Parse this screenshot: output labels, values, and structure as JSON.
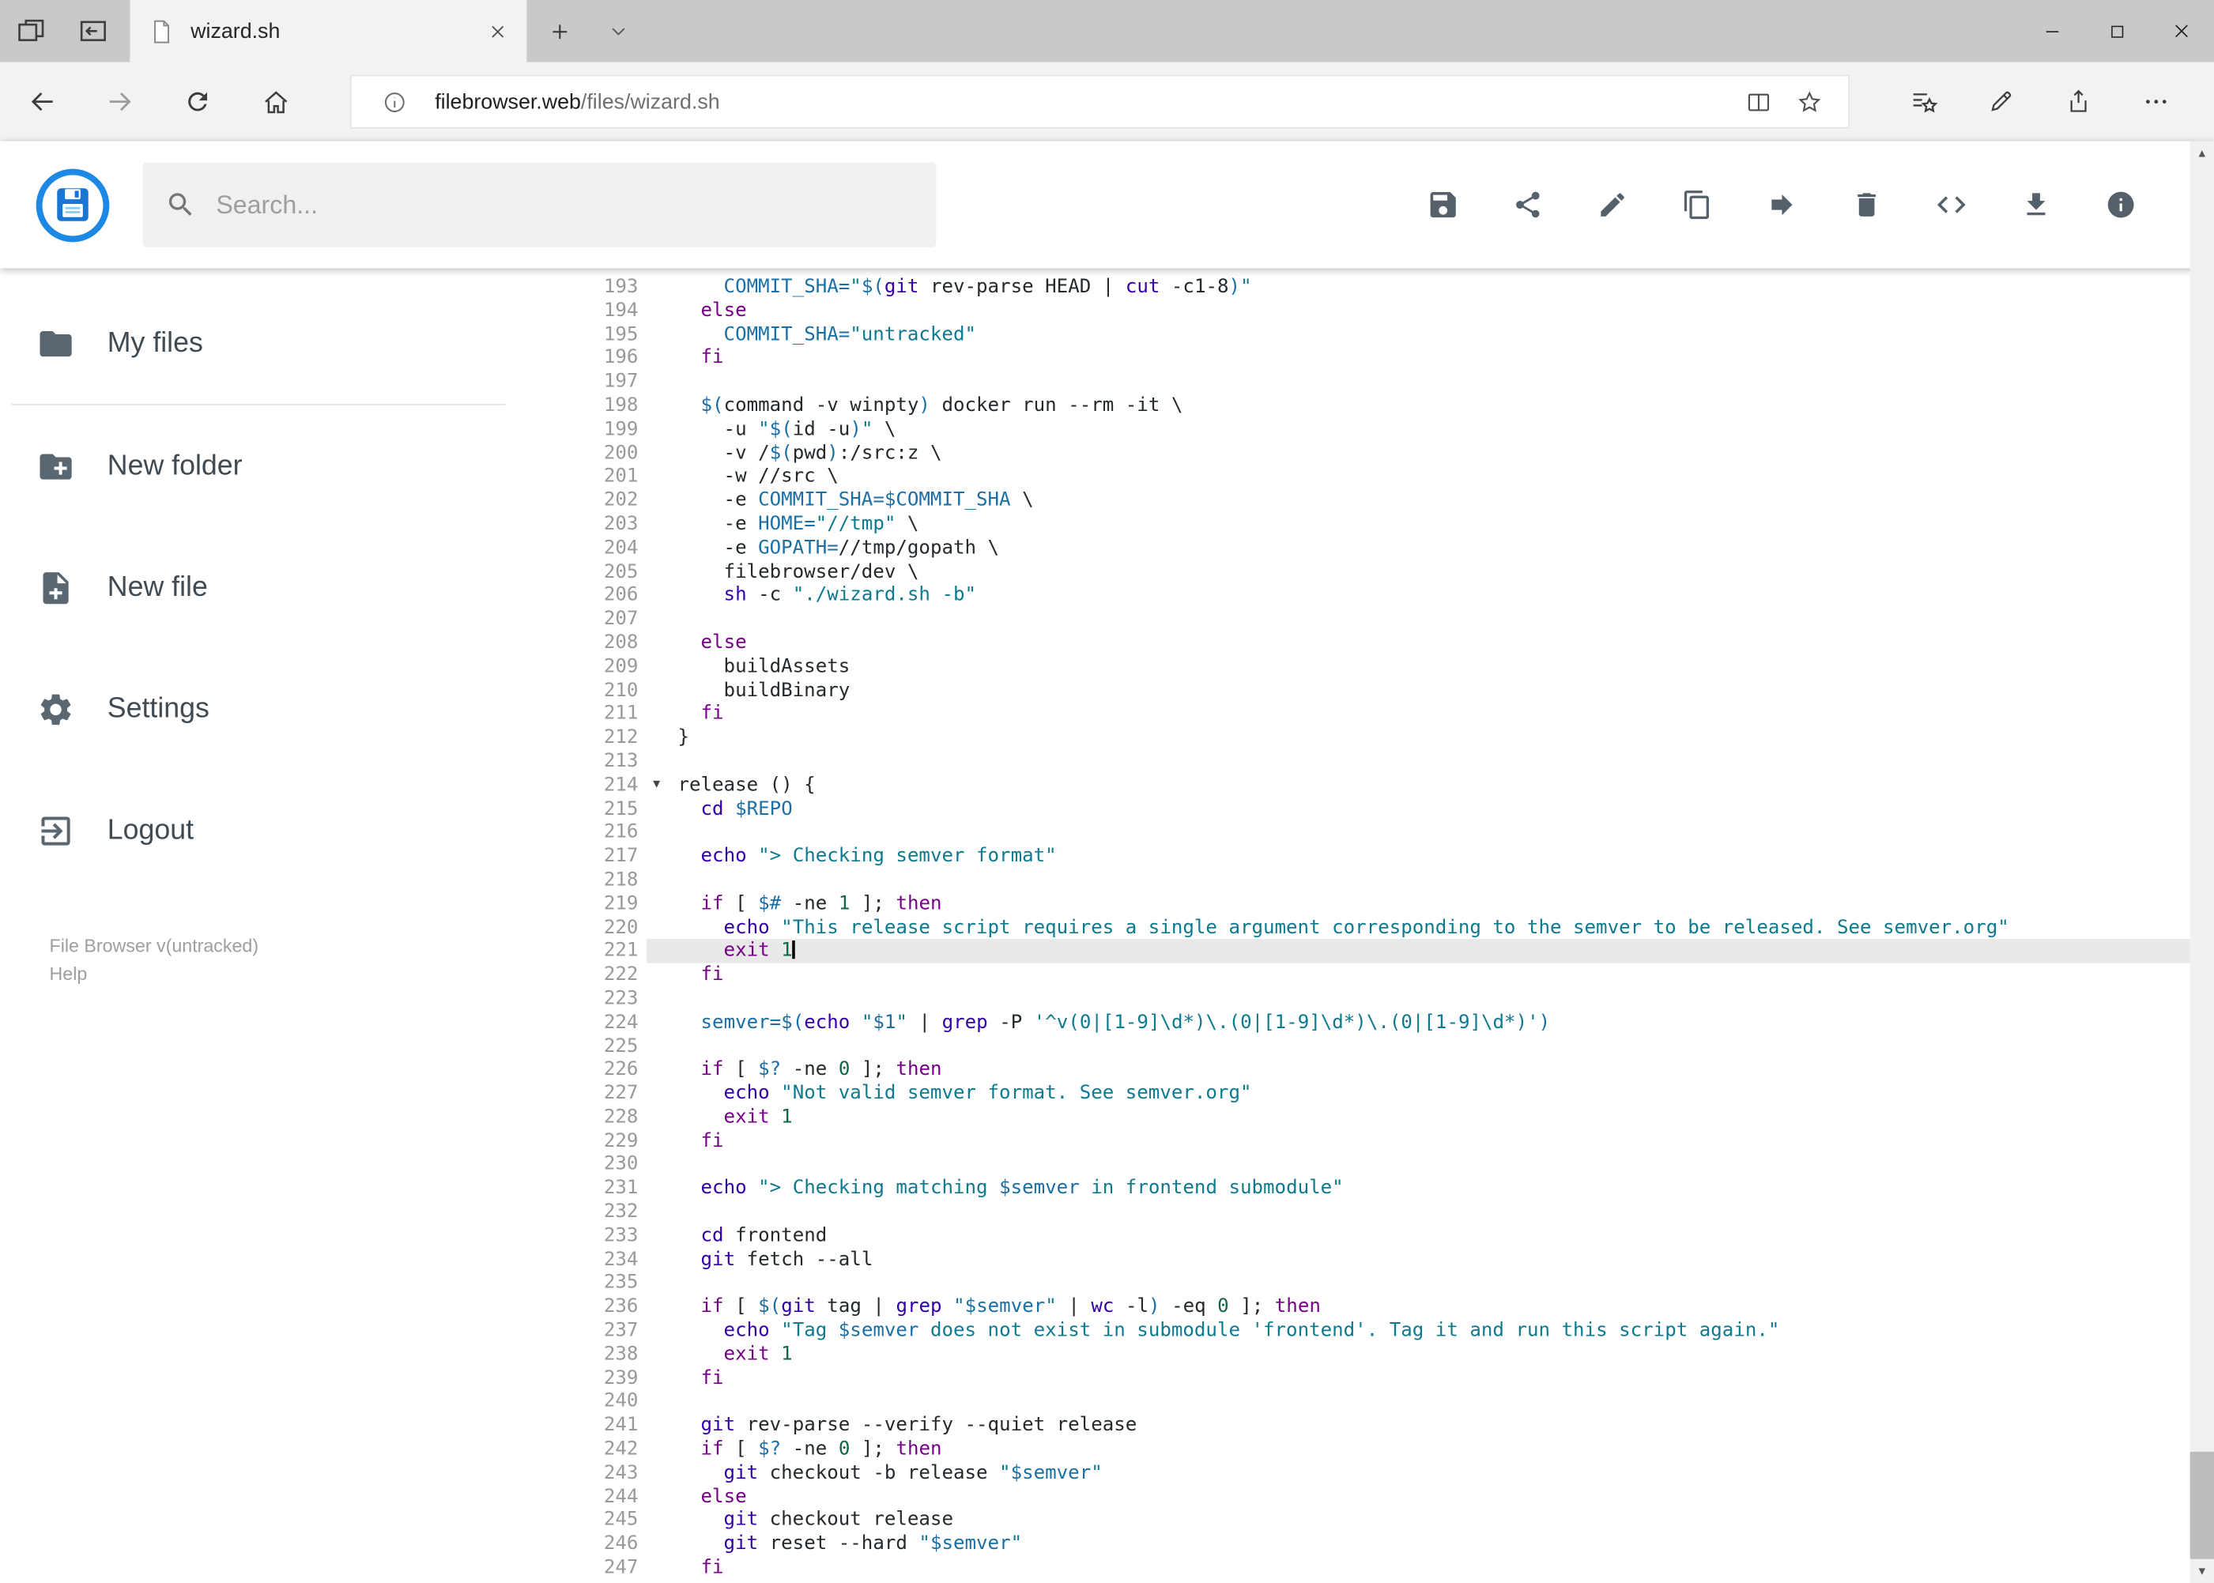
{
  "browser": {
    "tab": {
      "title": "wizard.sh"
    },
    "address": {
      "host": "filebrowser.web",
      "path": "/files/wizard.sh"
    }
  },
  "app_header": {
    "search_placeholder": "Search...",
    "toolbar_icons": [
      "save",
      "share",
      "rename",
      "copy",
      "move",
      "delete",
      "code",
      "download",
      "info"
    ]
  },
  "sidebar": {
    "items": [
      {
        "label": "My files",
        "icon": "folder"
      },
      {
        "label": "New folder",
        "icon": "create-new-folder"
      },
      {
        "label": "New file",
        "icon": "note-add"
      },
      {
        "label": "Settings",
        "icon": "settings-gear"
      },
      {
        "label": "Logout",
        "icon": "exit-to-app"
      }
    ],
    "footer": {
      "version": "File Browser v(untracked)",
      "help": "Help"
    }
  },
  "colors": {
    "accent": "#2196f3",
    "active_line": "#e8e8e8"
  },
  "editor": {
    "language": "shell",
    "active_line": 221,
    "cursor_line": 221,
    "lines": [
      {
        "n": 193,
        "segs": [
          [
            "    ",
            "d"
          ],
          [
            "COMMIT_SHA=",
            "v"
          ],
          [
            "\"",
            "s"
          ],
          [
            "$(",
            "v"
          ],
          [
            "git",
            "b"
          ],
          [
            " rev-parse HEAD | ",
            "d"
          ],
          [
            "cut",
            "b"
          ],
          [
            " -c1-8",
            "d"
          ],
          [
            ")",
            "v"
          ],
          [
            "\"",
            "s"
          ]
        ]
      },
      {
        "n": 194,
        "segs": [
          [
            "  ",
            "d"
          ],
          [
            "else",
            "k"
          ]
        ]
      },
      {
        "n": 195,
        "segs": [
          [
            "    ",
            "d"
          ],
          [
            "COMMIT_SHA=",
            "v"
          ],
          [
            "\"untracked\"",
            "s"
          ]
        ]
      },
      {
        "n": 196,
        "segs": [
          [
            "  ",
            "d"
          ],
          [
            "fi",
            "k"
          ]
        ]
      },
      {
        "n": 197,
        "segs": []
      },
      {
        "n": 198,
        "segs": [
          [
            "  ",
            "d"
          ],
          [
            "$(",
            "v"
          ],
          [
            "command -v winpty",
            "d"
          ],
          [
            ")",
            "v"
          ],
          [
            " docker run --rm -it \\",
            "d"
          ]
        ]
      },
      {
        "n": 199,
        "segs": [
          [
            "    -u ",
            "d"
          ],
          [
            "\"",
            "s"
          ],
          [
            "$(",
            "v"
          ],
          [
            "id -u",
            "d"
          ],
          [
            ")",
            "v"
          ],
          [
            "\"",
            "s"
          ],
          [
            " \\",
            "d"
          ]
        ]
      },
      {
        "n": 200,
        "segs": [
          [
            "    -v /",
            "d"
          ],
          [
            "$(",
            "v"
          ],
          [
            "pwd",
            "d"
          ],
          [
            ")",
            "v"
          ],
          [
            ":/src:z \\",
            "d"
          ]
        ]
      },
      {
        "n": 201,
        "segs": [
          [
            "    -w //src \\",
            "d"
          ]
        ]
      },
      {
        "n": 202,
        "segs": [
          [
            "    -e ",
            "d"
          ],
          [
            "COMMIT_SHA=",
            "v"
          ],
          [
            "$COMMIT_SHA",
            "v"
          ],
          [
            " \\",
            "d"
          ]
        ]
      },
      {
        "n": 203,
        "segs": [
          [
            "    -e ",
            "d"
          ],
          [
            "HOME=",
            "v"
          ],
          [
            "\"//tmp\"",
            "s"
          ],
          [
            " \\",
            "d"
          ]
        ]
      },
      {
        "n": 204,
        "segs": [
          [
            "    -e ",
            "d"
          ],
          [
            "GOPATH=",
            "v"
          ],
          [
            "//tmp/gopath \\",
            "d"
          ]
        ]
      },
      {
        "n": 205,
        "segs": [
          [
            "    filebrowser/dev \\",
            "d"
          ]
        ]
      },
      {
        "n": 206,
        "segs": [
          [
            "    ",
            "d"
          ],
          [
            "sh",
            "b"
          ],
          [
            " -c ",
            "d"
          ],
          [
            "\"./wizard.sh -b\"",
            "s"
          ]
        ]
      },
      {
        "n": 207,
        "segs": []
      },
      {
        "n": 208,
        "segs": [
          [
            "  ",
            "d"
          ],
          [
            "else",
            "k"
          ]
        ]
      },
      {
        "n": 209,
        "segs": [
          [
            "    buildAssets",
            "d"
          ]
        ]
      },
      {
        "n": 210,
        "segs": [
          [
            "    buildBinary",
            "d"
          ]
        ]
      },
      {
        "n": 211,
        "segs": [
          [
            "  ",
            "d"
          ],
          [
            "fi",
            "k"
          ]
        ]
      },
      {
        "n": 212,
        "segs": [
          [
            "}",
            "d"
          ]
        ]
      },
      {
        "n": 213,
        "segs": []
      },
      {
        "n": 214,
        "fold": true,
        "segs": [
          [
            "release () {",
            "d"
          ]
        ]
      },
      {
        "n": 215,
        "segs": [
          [
            "  ",
            "d"
          ],
          [
            "cd",
            "b"
          ],
          [
            " ",
            "d"
          ],
          [
            "$REPO",
            "v"
          ]
        ]
      },
      {
        "n": 216,
        "segs": []
      },
      {
        "n": 217,
        "segs": [
          [
            "  ",
            "d"
          ],
          [
            "echo",
            "b"
          ],
          [
            " ",
            "d"
          ],
          [
            "\"> Checking semver format\"",
            "s"
          ]
        ]
      },
      {
        "n": 218,
        "segs": []
      },
      {
        "n": 219,
        "segs": [
          [
            "  ",
            "d"
          ],
          [
            "if",
            "k"
          ],
          [
            " [ ",
            "d"
          ],
          [
            "$#",
            "v"
          ],
          [
            " -ne ",
            "d"
          ],
          [
            "1",
            "n"
          ],
          [
            " ]; ",
            "d"
          ],
          [
            "then",
            "k"
          ]
        ]
      },
      {
        "n": 220,
        "segs": [
          [
            "    ",
            "d"
          ],
          [
            "echo",
            "b"
          ],
          [
            " ",
            "d"
          ],
          [
            "\"This release script requires a single argument corresponding to the semver to be released. See semver.org\"",
            "s"
          ]
        ]
      },
      {
        "n": 221,
        "segs": [
          [
            "    ",
            "d"
          ],
          [
            "exit",
            "k"
          ],
          [
            " ",
            "d"
          ],
          [
            "1",
            "n"
          ]
        ]
      },
      {
        "n": 222,
        "segs": [
          [
            "  ",
            "d"
          ],
          [
            "fi",
            "k"
          ]
        ]
      },
      {
        "n": 223,
        "segs": []
      },
      {
        "n": 224,
        "segs": [
          [
            "  ",
            "d"
          ],
          [
            "semver=",
            "v"
          ],
          [
            "$(",
            "v"
          ],
          [
            "echo",
            "b"
          ],
          [
            " ",
            "d"
          ],
          [
            "\"",
            "s"
          ],
          [
            "$1",
            "v"
          ],
          [
            "\"",
            "s"
          ],
          [
            " | ",
            "d"
          ],
          [
            "grep",
            "b"
          ],
          [
            " -P ",
            "d"
          ],
          [
            "'^v(0|[1-9]\\d*)\\.(0|[1-9]\\d*)\\.(0|[1-9]\\d*)'",
            "s"
          ],
          [
            ")",
            "v"
          ]
        ]
      },
      {
        "n": 225,
        "segs": []
      },
      {
        "n": 226,
        "segs": [
          [
            "  ",
            "d"
          ],
          [
            "if",
            "k"
          ],
          [
            " [ ",
            "d"
          ],
          [
            "$?",
            "v"
          ],
          [
            " -ne ",
            "d"
          ],
          [
            "0",
            "n"
          ],
          [
            " ]; ",
            "d"
          ],
          [
            "then",
            "k"
          ]
        ]
      },
      {
        "n": 227,
        "segs": [
          [
            "    ",
            "d"
          ],
          [
            "echo",
            "b"
          ],
          [
            " ",
            "d"
          ],
          [
            "\"Not valid semver format. See semver.org\"",
            "s"
          ]
        ]
      },
      {
        "n": 228,
        "segs": [
          [
            "    ",
            "d"
          ],
          [
            "exit",
            "k"
          ],
          [
            " ",
            "d"
          ],
          [
            "1",
            "n"
          ]
        ]
      },
      {
        "n": 229,
        "segs": [
          [
            "  ",
            "d"
          ],
          [
            "fi",
            "k"
          ]
        ]
      },
      {
        "n": 230,
        "segs": []
      },
      {
        "n": 231,
        "segs": [
          [
            "  ",
            "d"
          ],
          [
            "echo",
            "b"
          ],
          [
            " ",
            "d"
          ],
          [
            "\"> Checking matching ",
            "s"
          ],
          [
            "$semver",
            "v"
          ],
          [
            " in frontend submodule\"",
            "s"
          ]
        ]
      },
      {
        "n": 232,
        "segs": []
      },
      {
        "n": 233,
        "segs": [
          [
            "  ",
            "d"
          ],
          [
            "cd",
            "b"
          ],
          [
            " frontend",
            "d"
          ]
        ]
      },
      {
        "n": 234,
        "segs": [
          [
            "  ",
            "d"
          ],
          [
            "git",
            "b"
          ],
          [
            " fetch --all",
            "d"
          ]
        ]
      },
      {
        "n": 235,
        "segs": []
      },
      {
        "n": 236,
        "segs": [
          [
            "  ",
            "d"
          ],
          [
            "if",
            "k"
          ],
          [
            " [ ",
            "d"
          ],
          [
            "$(",
            "v"
          ],
          [
            "git",
            "b"
          ],
          [
            " tag | ",
            "d"
          ],
          [
            "grep",
            "b"
          ],
          [
            " ",
            "d"
          ],
          [
            "\"",
            "s"
          ],
          [
            "$semver",
            "v"
          ],
          [
            "\"",
            "s"
          ],
          [
            " | ",
            "d"
          ],
          [
            "wc",
            "b"
          ],
          [
            " -l",
            "d"
          ],
          [
            ")",
            "v"
          ],
          [
            " -eq ",
            "d"
          ],
          [
            "0",
            "n"
          ],
          [
            " ]; ",
            "d"
          ],
          [
            "then",
            "k"
          ]
        ]
      },
      {
        "n": 237,
        "segs": [
          [
            "    ",
            "d"
          ],
          [
            "echo",
            "b"
          ],
          [
            " ",
            "d"
          ],
          [
            "\"Tag ",
            "s"
          ],
          [
            "$semver",
            "v"
          ],
          [
            " does not exist in submodule 'frontend'. Tag it and run this script again.\"",
            "s"
          ]
        ]
      },
      {
        "n": 238,
        "segs": [
          [
            "    ",
            "d"
          ],
          [
            "exit",
            "k"
          ],
          [
            " ",
            "d"
          ],
          [
            "1",
            "n"
          ]
        ]
      },
      {
        "n": 239,
        "segs": [
          [
            "  ",
            "d"
          ],
          [
            "fi",
            "k"
          ]
        ]
      },
      {
        "n": 240,
        "segs": []
      },
      {
        "n": 241,
        "segs": [
          [
            "  ",
            "d"
          ],
          [
            "git",
            "b"
          ],
          [
            " rev-parse --verify --quiet release",
            "d"
          ]
        ]
      },
      {
        "n": 242,
        "segs": [
          [
            "  ",
            "d"
          ],
          [
            "if",
            "k"
          ],
          [
            " [ ",
            "d"
          ],
          [
            "$?",
            "v"
          ],
          [
            " -ne ",
            "d"
          ],
          [
            "0",
            "n"
          ],
          [
            " ]; ",
            "d"
          ],
          [
            "then",
            "k"
          ]
        ]
      },
      {
        "n": 243,
        "segs": [
          [
            "    ",
            "d"
          ],
          [
            "git",
            "b"
          ],
          [
            " checkout -b release ",
            "d"
          ],
          [
            "\"",
            "s"
          ],
          [
            "$semver",
            "v"
          ],
          [
            "\"",
            "s"
          ]
        ]
      },
      {
        "n": 244,
        "segs": [
          [
            "  ",
            "d"
          ],
          [
            "else",
            "k"
          ]
        ]
      },
      {
        "n": 245,
        "segs": [
          [
            "    ",
            "d"
          ],
          [
            "git",
            "b"
          ],
          [
            " checkout release",
            "d"
          ]
        ]
      },
      {
        "n": 246,
        "segs": [
          [
            "    ",
            "d"
          ],
          [
            "git",
            "b"
          ],
          [
            " reset --hard ",
            "d"
          ],
          [
            "\"",
            "s"
          ],
          [
            "$semver",
            "v"
          ],
          [
            "\"",
            "s"
          ]
        ]
      },
      {
        "n": 247,
        "segs": [
          [
            "  ",
            "d"
          ],
          [
            "fi",
            "k"
          ]
        ]
      }
    ]
  }
}
